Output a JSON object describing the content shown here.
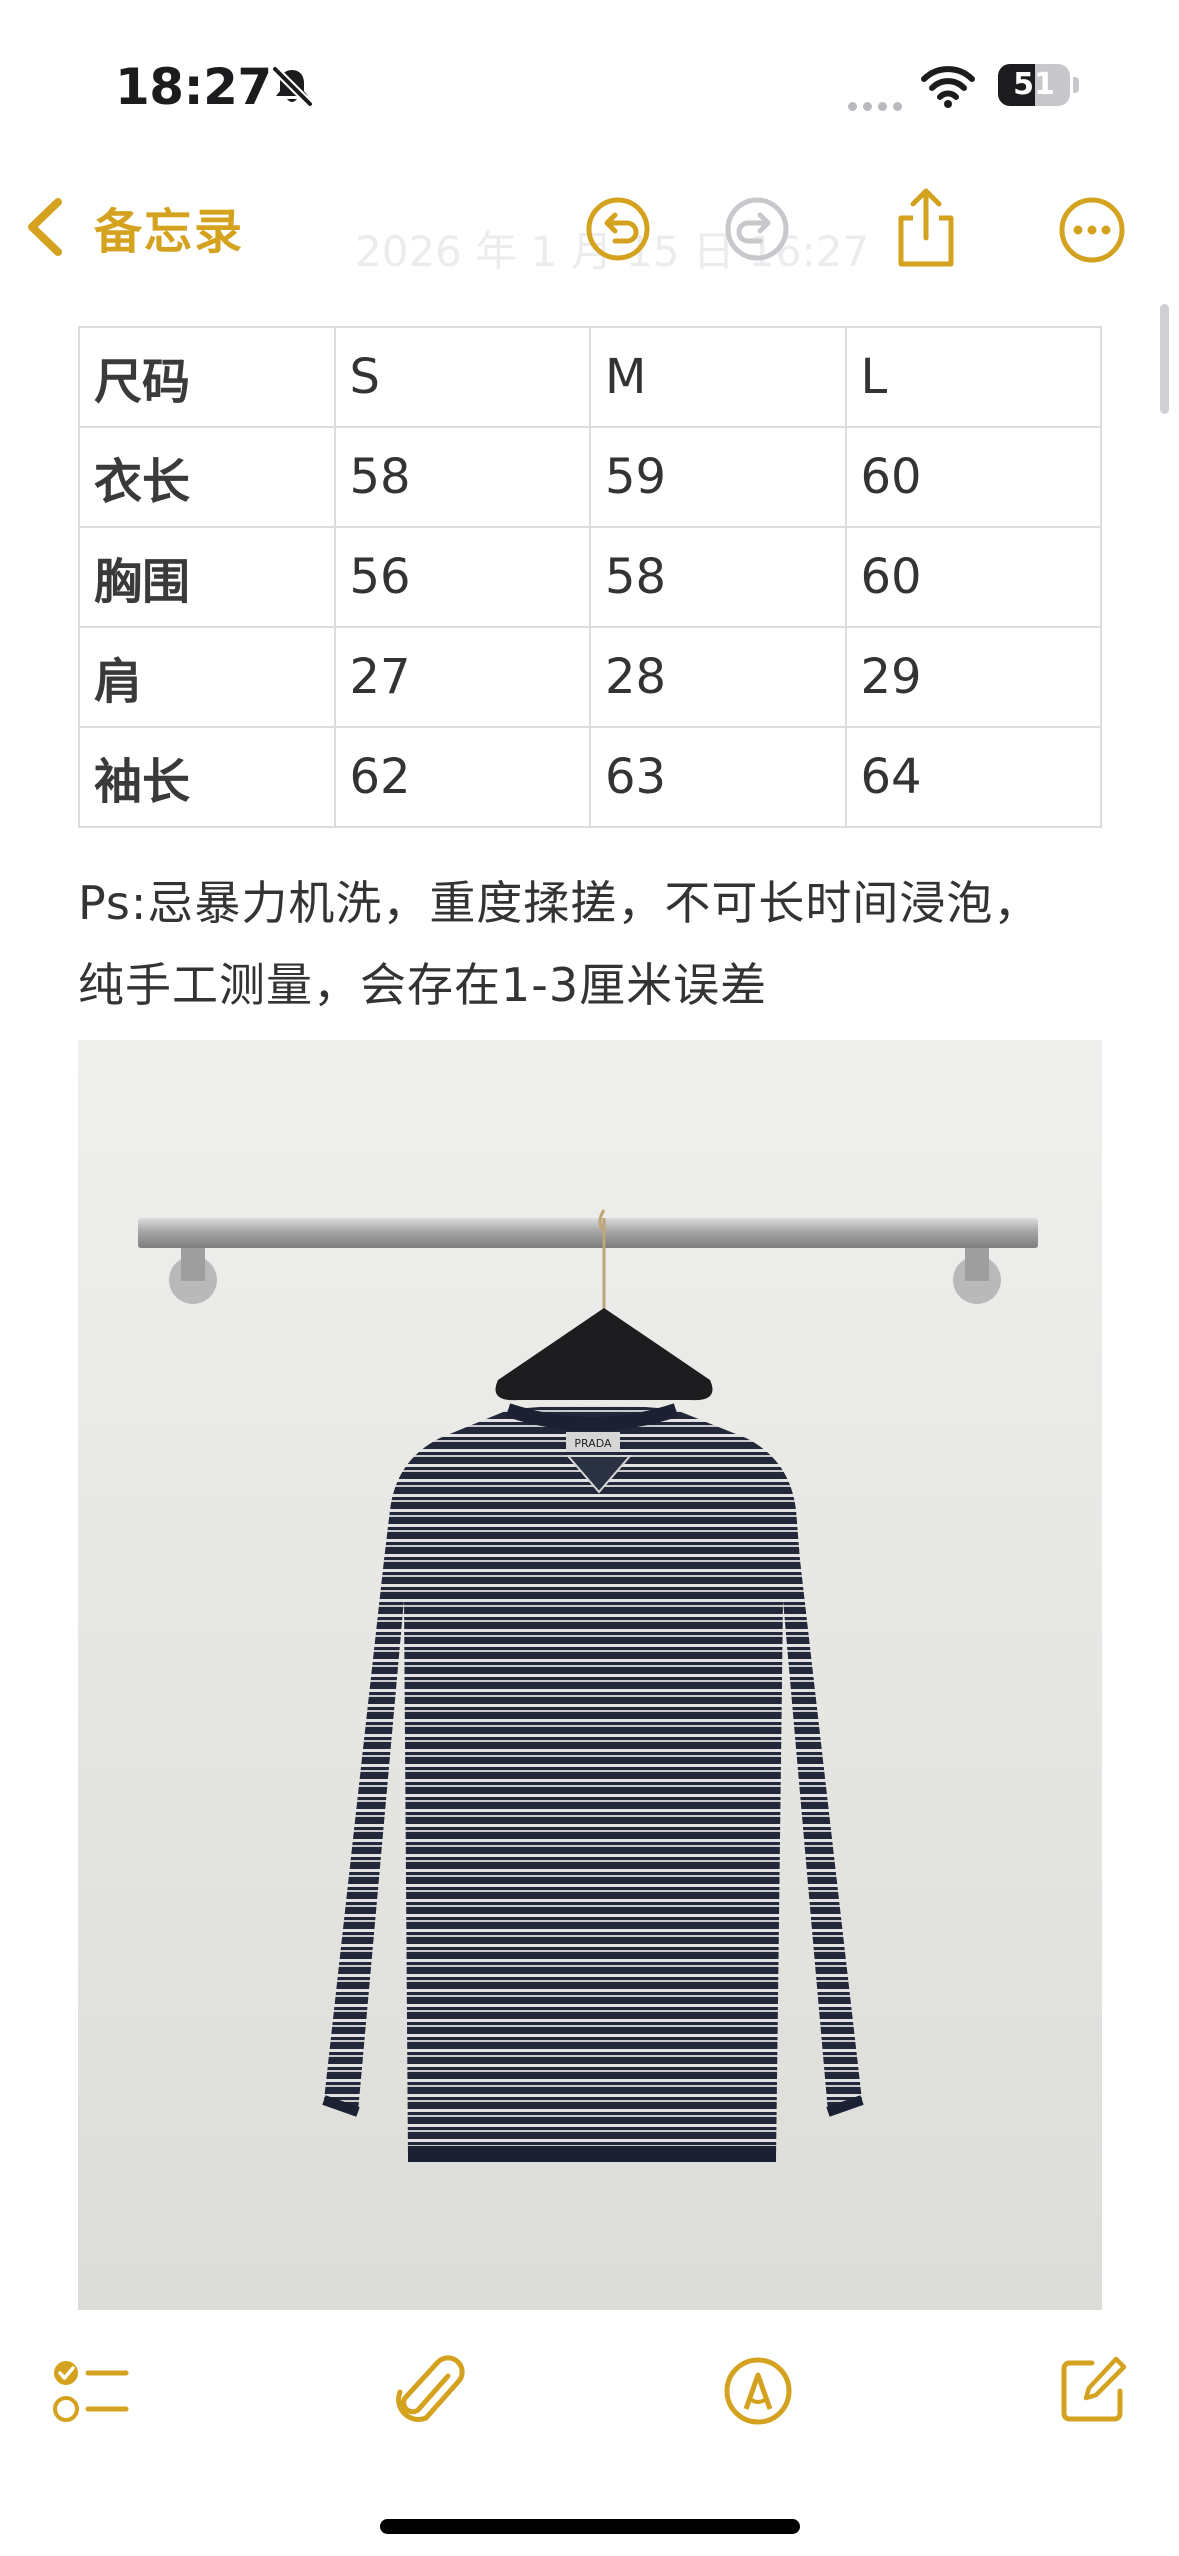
{
  "status_bar": {
    "time": "18:27",
    "battery_level": "51",
    "icons": [
      "bell-slash-icon",
      "cellular-signal-icon",
      "wifi-icon",
      "battery-icon"
    ]
  },
  "nav": {
    "back_label": "备忘录",
    "faded_date": "2026 年 1 月 15 日 16:27",
    "icons": [
      "chevron-left-icon",
      "undo-icon",
      "redo-icon",
      "share-icon",
      "more-icon"
    ]
  },
  "size_table": {
    "header": [
      "尺码",
      "S",
      "M",
      "L"
    ],
    "rows": [
      [
        "衣长",
        "58",
        "59",
        "60"
      ],
      [
        "胸围",
        "56",
        "58",
        "60"
      ],
      [
        "肩",
        "27",
        "28",
        "29"
      ],
      [
        "袖长",
        "62",
        "63",
        "64"
      ]
    ]
  },
  "note": {
    "lines": [
      "Ps:忌暴力机洗，重度揉搓，不可长时间浸泡，",
      "纯手工测量，会存在1-3厘米误差"
    ]
  },
  "photo": {
    "logo_text": "PRADA"
  },
  "toolbar": {
    "icons": [
      "checklist-icon",
      "paperclip-icon",
      "markup-pen-icon",
      "compose-icon"
    ]
  },
  "colors": {
    "accent": "#d4a21e",
    "disabled": "#c7c7cc",
    "text": "#333336",
    "table_border": "#dcdcdf"
  }
}
